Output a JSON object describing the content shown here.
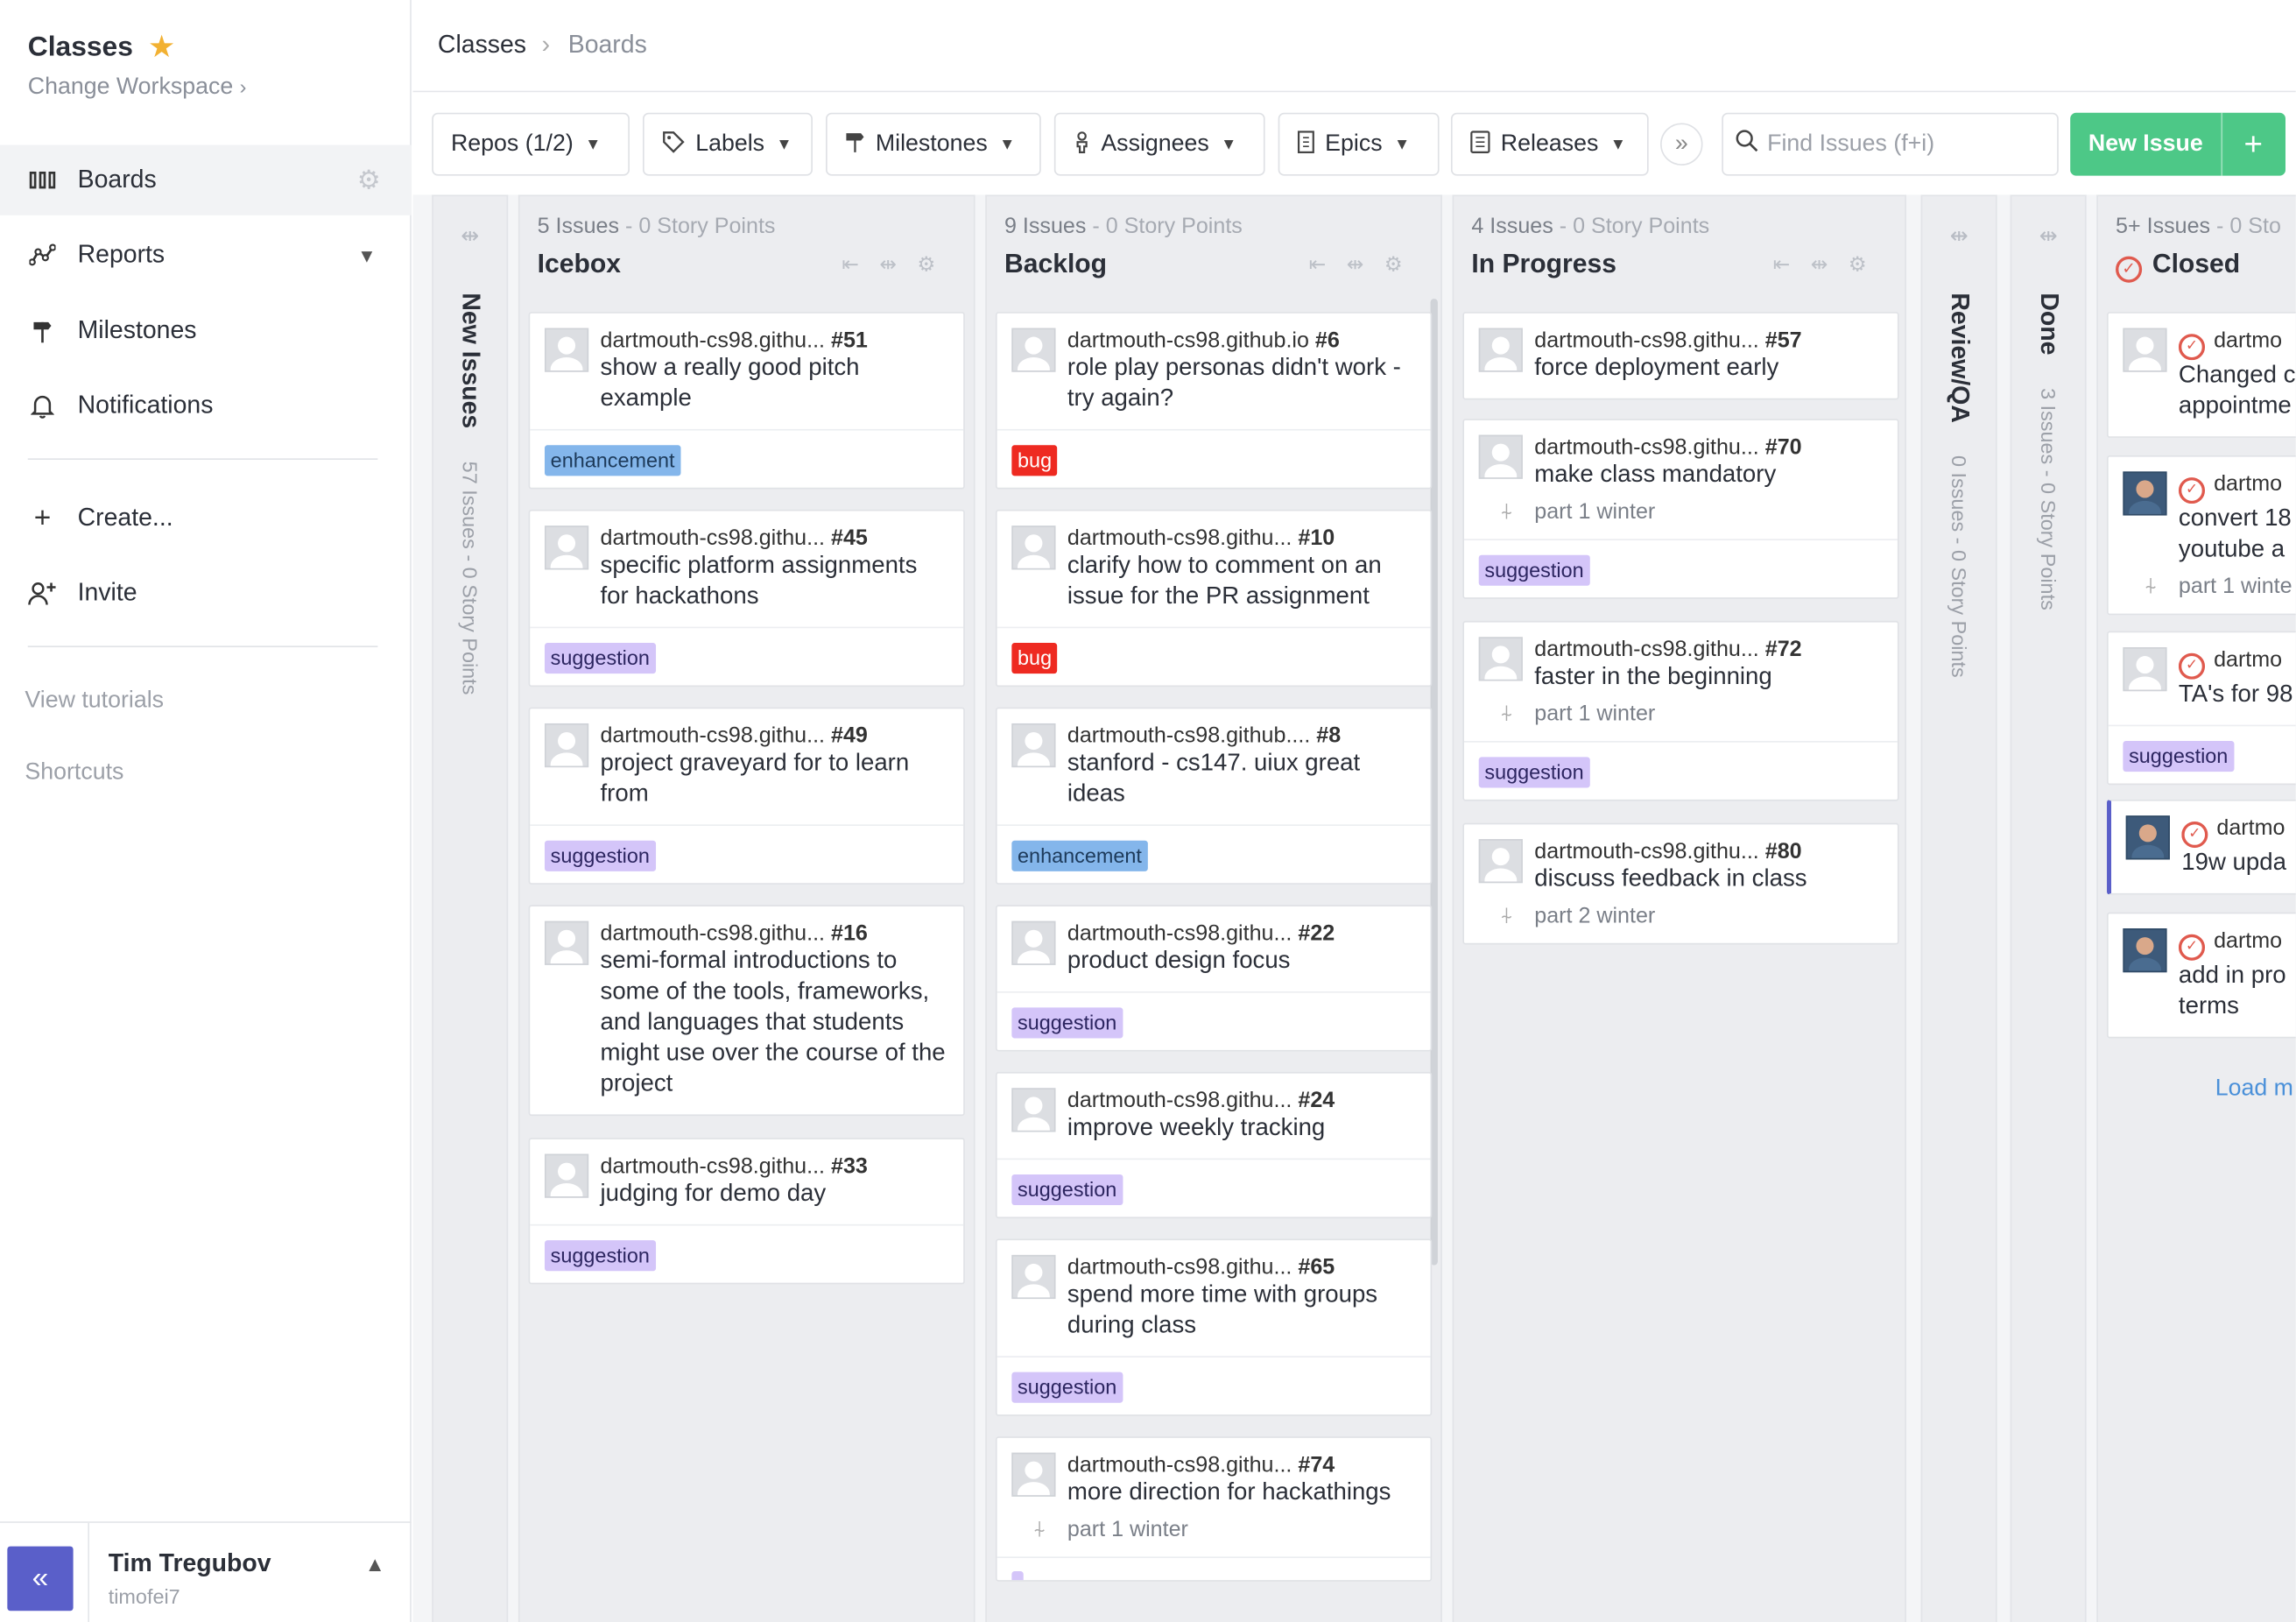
{
  "workspace": {
    "title": "Classes",
    "change": "Change Workspace",
    "change_chevron": "›"
  },
  "nav": {
    "boards": "Boards",
    "reports": "Reports",
    "milestones": "Milestones",
    "notifications": "Notifications",
    "create": "Create...",
    "invite": "Invite",
    "tutorials": "View tutorials",
    "shortcuts": "Shortcuts"
  },
  "user": {
    "name": "Tim Tregubov",
    "handle": "timofei7"
  },
  "breadcrumb": {
    "root": "Classes",
    "sep": "›",
    "current": "Boards"
  },
  "toolbar": {
    "repos": "Repos (1/2)",
    "labels": "Labels",
    "milestones": "Milestones",
    "assignees": "Assignees",
    "epics": "Epics",
    "releases": "Releases",
    "more": "»",
    "search_placeholder": "Find Issues (f+i)",
    "new_issue": "New Issue",
    "new_plus": "+"
  },
  "columns": {
    "new_issues": {
      "name": "New Issues",
      "count": "57 Issues - 0 Story Points"
    },
    "icebox": {
      "meta_a": "5 Issues",
      "meta_b": " - 0 Story Points",
      "title": "Icebox"
    },
    "backlog": {
      "meta_a": "9 Issues",
      "meta_b": " - 0 Story Points",
      "title": "Backlog"
    },
    "in_progress": {
      "meta_a": "4 Issues",
      "meta_b": " - 0 Story Points",
      "title": "In Progress"
    },
    "review_qa": {
      "name": "Review/QA",
      "count": "0 Issues - 0 Story Points"
    },
    "done": {
      "name": "Done",
      "count": "3 Issues - 0 Story Points"
    },
    "closed": {
      "meta_a": "5+ Issues",
      "meta_b": " - 0 Sto",
      "title": "Closed",
      "load_more": "Load m"
    }
  },
  "icebox_cards": [
    {
      "repo": "dartmouth-cs98.githu...",
      "num": "#51",
      "title": "show a really good pitch example",
      "label": "enhancement"
    },
    {
      "repo": "dartmouth-cs98.githu...",
      "num": "#45",
      "title": "specific platform assignments for hackathons",
      "label": "suggestion"
    },
    {
      "repo": "dartmouth-cs98.githu...",
      "num": "#49",
      "title": "project graveyard for to learn from",
      "label": "suggestion"
    },
    {
      "repo": "dartmouth-cs98.githu...",
      "num": "#16",
      "title": "semi-formal introductions to some of the tools, frameworks, and languages that students might use over the course of the project",
      "label": ""
    },
    {
      "repo": "dartmouth-cs98.githu...",
      "num": "#33",
      "title": "judging for demo day",
      "label": "suggestion"
    }
  ],
  "backlog_cards": [
    {
      "repo": "dartmouth-cs98.github.io",
      "num": "#6",
      "title": "role play personas didn't work - try again?",
      "label": "bug"
    },
    {
      "repo": "dartmouth-cs98.githu...",
      "num": "#10",
      "title": "clarify how to comment on an issue for the PR assignment",
      "label": "bug"
    },
    {
      "repo": "dartmouth-cs98.github....",
      "num": "#8",
      "title": "stanford - cs147. uiux great ideas",
      "label": "enhancement"
    },
    {
      "repo": "dartmouth-cs98.githu...",
      "num": "#22",
      "title": "product design focus",
      "label": "suggestion"
    },
    {
      "repo": "dartmouth-cs98.githu...",
      "num": "#24",
      "title": "improve weekly tracking",
      "label": "suggestion"
    },
    {
      "repo": "dartmouth-cs98.githu...",
      "num": "#65",
      "title": "spend more time with groups during class",
      "label": "suggestion"
    },
    {
      "repo": "dartmouth-cs98.githu...",
      "num": "#74",
      "title": "more direction for hackathings",
      "milestone": "part 1 winter"
    }
  ],
  "progress_cards": [
    {
      "repo": "dartmouth-cs98.githu...",
      "num": "#57",
      "title": "force deployment early"
    },
    {
      "repo": "dartmouth-cs98.githu...",
      "num": "#70",
      "title": "make class mandatory",
      "milestone": "part 1 winter",
      "label": "suggestion"
    },
    {
      "repo": "dartmouth-cs98.githu...",
      "num": "#72",
      "title": "faster in the beginning",
      "milestone": "part 1 winter",
      "label": "suggestion"
    },
    {
      "repo": "dartmouth-cs98.githu...",
      "num": "#80",
      "title": "discuss feedback in class",
      "milestone": "part 2 winter"
    }
  ],
  "closed_cards": [
    {
      "repo": "dartmo",
      "title": "Changed c appointme"
    },
    {
      "repo": "dartmo",
      "title": "convert 18 youtube a",
      "milestone": "part 1 winte"
    },
    {
      "repo": "dartmo",
      "title": "TA's for 98",
      "label": "suggestion"
    },
    {
      "repo": "dartmo",
      "title": "19w upda"
    },
    {
      "repo": "dartmo",
      "title": "add in pro terms"
    }
  ],
  "label_names": {
    "enhancement": "enhancement",
    "bug": "bug",
    "suggestion": "suggestion"
  },
  "colors": {
    "accent": "#5a5fc9",
    "new_issue": "#4dc887",
    "star": "#f2b132",
    "closed": "#e05a4e"
  },
  "icons": [
    "star-icon",
    "boards-icon",
    "reports-icon",
    "milestone-icon",
    "bell-icon",
    "plus-icon",
    "invite-icon",
    "gear-icon",
    "tag-icon",
    "person-icon",
    "epic-icon",
    "release-icon",
    "search-icon",
    "collapse-icon",
    "closed-issue-icon"
  ]
}
